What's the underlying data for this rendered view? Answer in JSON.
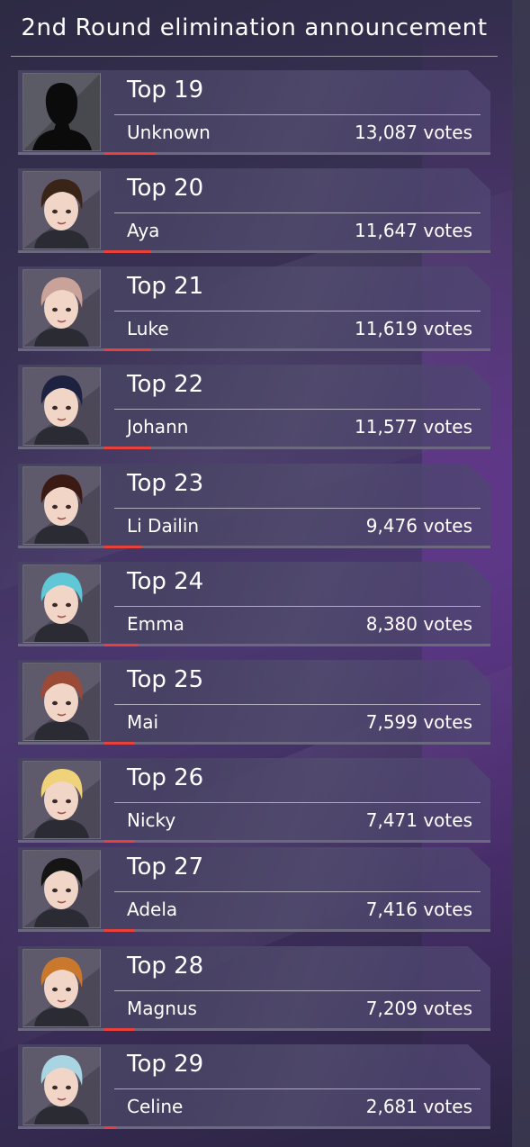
{
  "header": {
    "title": "2nd Round elimination announcement"
  },
  "colors": {
    "accent_bar": "#e8413b",
    "card_bg": "#48445f",
    "text": "#ffffff"
  },
  "entries": [
    {
      "rank": "Top 19",
      "name": "Unknown",
      "votes": "13,087 votes",
      "vote_count": 13087,
      "portrait": "silhouette-icon",
      "hair": "#111111"
    },
    {
      "rank": "Top 20",
      "name": "Aya",
      "votes": "11,647 votes",
      "vote_count": 11647,
      "portrait": "aya-portrait",
      "hair": "#3a2418"
    },
    {
      "rank": "Top 21",
      "name": "Luke",
      "votes": "11,619 votes",
      "vote_count": 11619,
      "portrait": "luke-portrait",
      "hair": "#c9a29a"
    },
    {
      "rank": "Top 22",
      "name": "Johann",
      "votes": "11,577 votes",
      "vote_count": 11577,
      "portrait": "johann-portrait",
      "hair": "#1d2240"
    },
    {
      "rank": "Top 23",
      "name": "Li Dailin",
      "votes": "9,476 votes",
      "vote_count": 9476,
      "portrait": "li-dailin-portrait",
      "hair": "#3a1a12"
    },
    {
      "rank": "Top 24",
      "name": "Emma",
      "votes": "8,380 votes",
      "vote_count": 8380,
      "portrait": "emma-portrait",
      "hair": "#5fc7d6"
    },
    {
      "rank": "Top 25",
      "name": "Mai",
      "votes": "7,599 votes",
      "vote_count": 7599,
      "portrait": "mai-portrait",
      "hair": "#9a4a36"
    },
    {
      "rank": "Top 26",
      "name": "Nicky",
      "votes": "7,471 votes",
      "vote_count": 7471,
      "portrait": "nicky-portrait",
      "hair": "#f0d27a"
    },
    {
      "rank": "Top 27",
      "name": "Adela",
      "votes": "7,416 votes",
      "vote_count": 7416,
      "portrait": "adela-portrait",
      "hair": "#151515"
    },
    {
      "rank": "Top 28",
      "name": "Magnus",
      "votes": "7,209 votes",
      "vote_count": 7209,
      "portrait": "magnus-portrait",
      "hair": "#c9782e"
    },
    {
      "rank": "Top 29",
      "name": "Celine",
      "votes": "2,681 votes",
      "vote_count": 2681,
      "portrait": "celine-portrait",
      "hair": "#a9d4e2"
    }
  ]
}
